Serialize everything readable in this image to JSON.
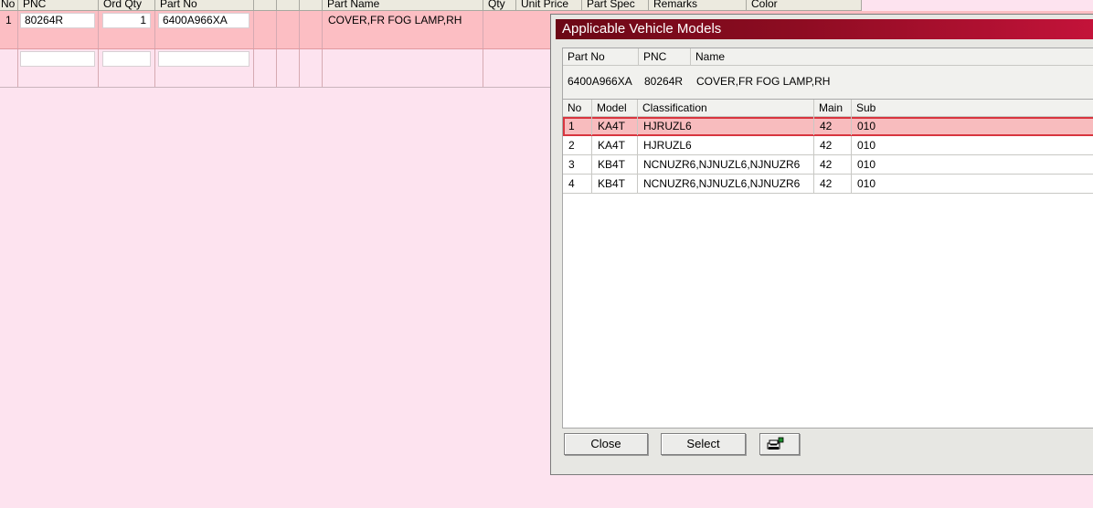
{
  "background_grid": {
    "headers": [
      "No",
      "PNC",
      "Ord Qty",
      "Part No",
      "",
      "",
      "",
      "Part Name",
      "Qty",
      "Unit Price",
      "Part Spec",
      "Remarks",
      "Color"
    ],
    "row1": {
      "no": "1",
      "pnc": "80264R",
      "ord_qty": "1",
      "part_no": "6400A966XA",
      "part_name": "COVER,FR FOG LAMP,RH"
    },
    "row2": {
      "pnc": "",
      "ord_qty": "",
      "part_no": ""
    }
  },
  "dialog": {
    "title": "Applicable Vehicle Models",
    "part_header": [
      "Part No",
      "PNC",
      "Name"
    ],
    "part": {
      "part_no": "6400A966XA",
      "pnc": "80264R",
      "name": "COVER,FR FOG LAMP,RH"
    },
    "list_headers": [
      "No",
      "Model",
      "Classification",
      "Main",
      "Sub"
    ],
    "rows": [
      [
        "1",
        "KA4T",
        "HJRUZL6",
        "42",
        "010"
      ],
      [
        "2",
        "KA4T",
        "HJRUZL6",
        "42",
        "010"
      ],
      [
        "3",
        "KB4T",
        "NCNUZR6,NJNUZL6,NJNUZR6",
        "42",
        "010"
      ],
      [
        "4",
        "KB4T",
        "NCNUZR6,NJNUZL6,NJNUZR6",
        "42",
        "010"
      ]
    ],
    "selected_row": 1,
    "buttons": {
      "close": "Close",
      "select": "Select"
    },
    "print_icon": "printer-icon"
  },
  "colors": {
    "background": "#fde3ef",
    "selected_row": "#fcbec3",
    "title_start": "#6b0816",
    "title_end": "#c4133a"
  }
}
